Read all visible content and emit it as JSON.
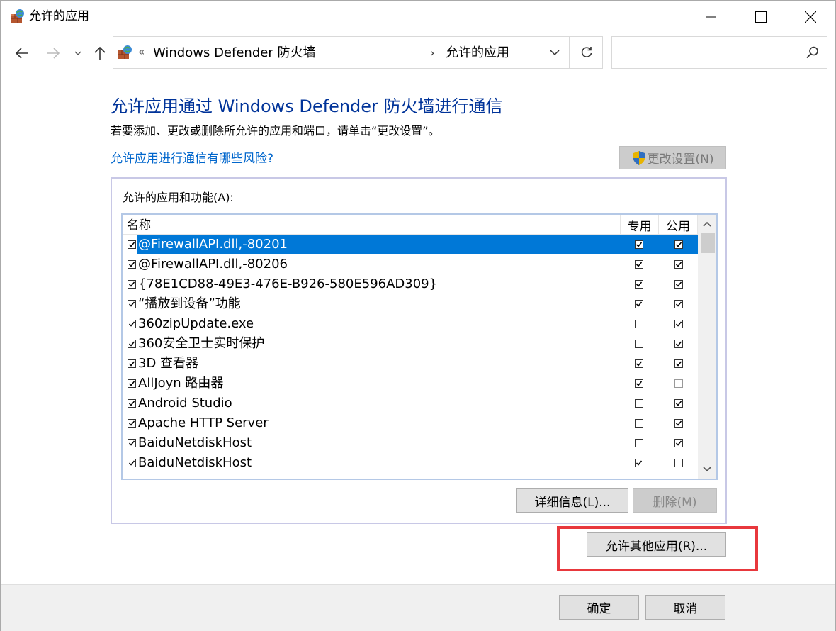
{
  "window": {
    "title": "允许的应用"
  },
  "nav": {
    "separator": "«",
    "crumbs": [
      "Windows Defender 防火墙",
      "允许的应用"
    ],
    "crumb_arrow": "›",
    "search_placeholder": ""
  },
  "main": {
    "heading": "允许应用通过 Windows Defender 防火墙进行通信",
    "subtext": "若要添加、更改或删除所允许的应用和端口，请单击“更改设置”。",
    "risk_link": "允许应用进行通信有哪些风险?",
    "change_settings": "更改设置(N)",
    "group_label": "允许的应用和功能(A):",
    "columns": {
      "name": "名称",
      "private": "专用",
      "public": "公用"
    },
    "rows": [
      {
        "name": "@FirewallAPI.dll,-80201",
        "enabled": true,
        "private": true,
        "public": true,
        "selected": true
      },
      {
        "name": "@FirewallAPI.dll,-80206",
        "enabled": true,
        "private": true,
        "public": true,
        "selected": false
      },
      {
        "name": "{78E1CD88-49E3-476E-B926-580E596AD309}",
        "enabled": true,
        "private": true,
        "public": true,
        "selected": false
      },
      {
        "name": "“播放到设备”功能",
        "enabled": true,
        "private": true,
        "public": true,
        "selected": false
      },
      {
        "name": "360zipUpdate.exe",
        "enabled": true,
        "private": false,
        "public": true,
        "selected": false
      },
      {
        "name": "360安全卫士实时保护",
        "enabled": true,
        "private": false,
        "public": true,
        "selected": false
      },
      {
        "name": "3D 查看器",
        "enabled": true,
        "private": true,
        "public": true,
        "selected": false
      },
      {
        "name": "AllJoyn 路由器",
        "enabled": true,
        "private": true,
        "public": false,
        "selected": false
      },
      {
        "name": "Android Studio",
        "enabled": true,
        "private": false,
        "public": true,
        "selected": false
      },
      {
        "name": "Apache HTTP Server",
        "enabled": true,
        "private": false,
        "public": true,
        "selected": false
      },
      {
        "name": "BaiduNetdiskHost",
        "enabled": true,
        "private": false,
        "public": true,
        "selected": false
      },
      {
        "name": "BaiduNetdiskHost",
        "enabled": true,
        "private": true,
        "public": false,
        "selected": false
      }
    ],
    "details_button": "详细信息(L)...",
    "delete_button": "删除(M)",
    "allow_other_button": "允许其他应用(R)..."
  },
  "footer": {
    "ok": "确定",
    "cancel": "取消"
  },
  "colors": {
    "heading": "#003399",
    "link": "#0066cc",
    "selection": "#0078d7",
    "highlight": "#e8383d"
  }
}
